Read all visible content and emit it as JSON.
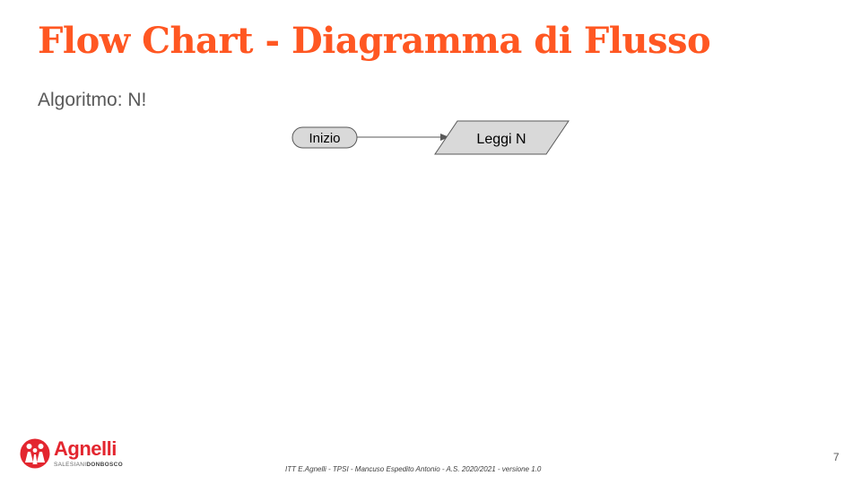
{
  "slide": {
    "title": "Flow Chart - Diagramma di Flusso",
    "subtitle": "Algoritmo: N!"
  },
  "flowchart": {
    "nodes": [
      {
        "id": "start",
        "shape": "terminator",
        "label": "Inizio"
      },
      {
        "id": "read-n",
        "shape": "input-output",
        "label": "Leggi N"
      }
    ],
    "edges": [
      {
        "from": "start",
        "to": "read-n"
      }
    ]
  },
  "footer": {
    "text": "ITT E.Agnelli - TPSI - Mancuso Espedito Antonio - A.S. 2020/2021 - versione 1.0",
    "page_number": "7"
  },
  "logo": {
    "name": "Agnelli",
    "tagline_light": "SALESIANI",
    "tagline_bold": "DONBOSCO"
  },
  "colors": {
    "title": "#ff5722",
    "shape_fill": "#d9d9d9",
    "shape_stroke": "#595959",
    "logo_red": "#e3262f"
  }
}
